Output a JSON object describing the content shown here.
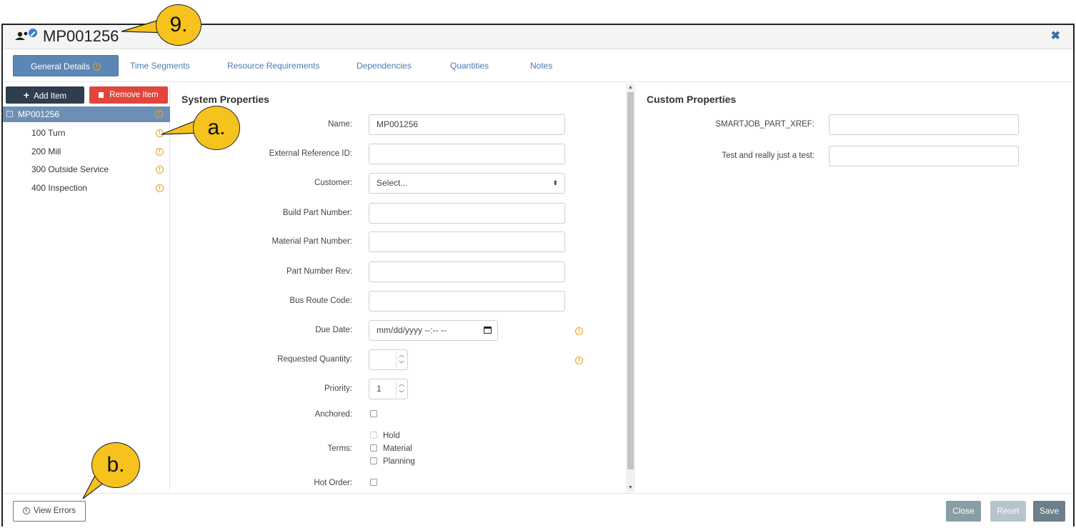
{
  "dialog": {
    "title": "MP001256",
    "title_icon": "user-edit-icon",
    "close_icon": "close-icon"
  },
  "tabs": [
    {
      "label": "General Details",
      "active": true,
      "has_info": true
    },
    {
      "label": "Time Segments"
    },
    {
      "label": "Resource Requirements"
    },
    {
      "label": "Dependencies"
    },
    {
      "label": "Quantities"
    },
    {
      "label": "Notes"
    }
  ],
  "sidebar": {
    "add_label": "Add Item",
    "remove_label": "Remove Item",
    "root": "MP001256",
    "items": [
      "100 Turn",
      "200 Mill",
      "300 Outside Service",
      "400 Inspection"
    ]
  },
  "system": {
    "title": "System Properties",
    "name_label": "Name:",
    "name_value": "MP001256",
    "extref_label": "External Reference ID:",
    "customer_label": "Customer:",
    "customer_value": "Select...",
    "build_label": "Build Part Number:",
    "material_label": "Material Part Number:",
    "rev_label": "Part Number Rev:",
    "bus_label": "Bus Route Code:",
    "due_label": "Due Date:",
    "due_placeholder": "mm/dd/yyyy --:-- --",
    "reqqty_label": "Requested Quantity:",
    "priority_label": "Priority:",
    "priority_value": "1",
    "anchored_label": "Anchored:",
    "terms_label": "Terms:",
    "terms": [
      "Hold",
      "Material",
      "Planning"
    ],
    "hot_label": "Hot Order:"
  },
  "custom": {
    "title": "Custom Properties",
    "xref_label": "SMARTJOB_PART_XREF:",
    "test_label": "Test and really just a test:"
  },
  "footer": {
    "errors_label": "View Errors",
    "close_label": "Close",
    "reset_label": "Reset",
    "save_label": "Save"
  },
  "callouts": {
    "title_marker": "9.",
    "item_marker": "a.",
    "errors_marker": "b."
  },
  "colors": {
    "accent": "#5b87b6",
    "remove": "#e2453c",
    "warning": "#e6a117",
    "callout": "#f6c21e"
  }
}
